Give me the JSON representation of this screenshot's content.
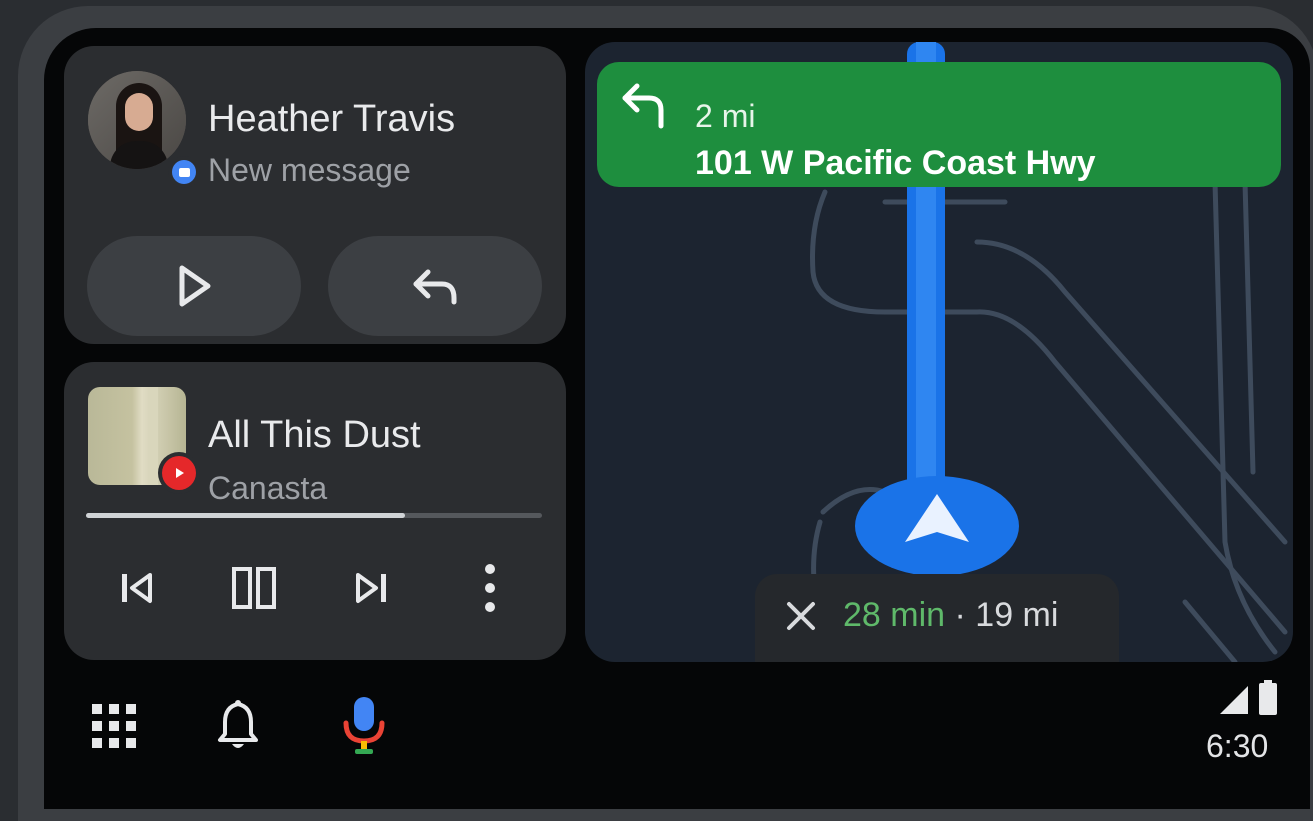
{
  "message_card": {
    "sender": "Heather Travis",
    "status": "New message",
    "avatar_icon": "person-avatar",
    "badge_icon": "messages-app-icon",
    "play_icon": "play-icon",
    "reply_icon": "reply-icon"
  },
  "media_card": {
    "track": "All This Dust",
    "artist": "Canasta",
    "source_icon": "youtube-music-icon",
    "progress": 0.7,
    "controls": [
      "skip-previous-icon",
      "pause-icon",
      "skip-next-icon",
      "more-vert-icon"
    ]
  },
  "navigation": {
    "maneuver_icon": "turn-left-icon",
    "distance": "2 mi",
    "street": "101 W Pacific Coast Hwy",
    "eta_time": "28 min",
    "eta_separator": " · ",
    "eta_distance": "19 mi",
    "close_icon": "close-icon",
    "banner_color": "#1e8e3e",
    "route_color": "#1a73e8"
  },
  "rail": {
    "apps_icon": "app-grid-icon",
    "notifications_icon": "bell-icon",
    "assistant_icon": "microphone-icon",
    "signal_icon": "signal-icon",
    "battery_icon": "battery-icon",
    "time": "6:30"
  }
}
